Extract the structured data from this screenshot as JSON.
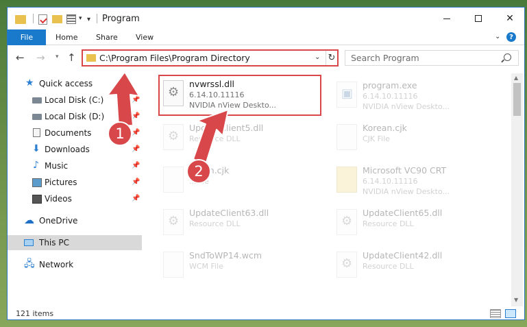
{
  "window": {
    "title": "Program",
    "ribbon_tabs": {
      "file": "File",
      "home": "Home",
      "share": "Share",
      "view": "View"
    },
    "help": "?"
  },
  "nav": {
    "address": "C:\\Program Files\\Program Directory",
    "search_placeholder": "Search Program"
  },
  "sidebar": {
    "quick_access": "Quick access",
    "items": [
      {
        "label": "Local Disk (C:)"
      },
      {
        "label": "Local Disk (D:)"
      },
      {
        "label": "Documents"
      },
      {
        "label": "Downloads"
      },
      {
        "label": "Music"
      },
      {
        "label": "Pictures"
      },
      {
        "label": "Videos"
      }
    ],
    "onedrive": "OneDrive",
    "this_pc": "This PC",
    "network": "Network"
  },
  "files": [
    {
      "name": "nvwrssl.dll",
      "line2": "6.14.10.11116",
      "line3": "NVIDIA nView Deskto..."
    },
    {
      "name": "program.exe",
      "line2": "6.14.10.11116",
      "line3": "NVIDIA nView Deskto..."
    },
    {
      "name": "UpdateClient5.dll",
      "line2": "Resource DLL",
      "line3": ""
    },
    {
      "name": "Korean.cjk",
      "line2": "CJK File",
      "line3": ""
    },
    {
      "name": "...tem.cjk",
      "line2": "...File",
      "line3": ""
    },
    {
      "name": "Microsoft VC90 CRT",
      "line2": "6.14.10.11116",
      "line3": "NVIDIA nView Deskto..."
    },
    {
      "name": "UpdateClient63.dll",
      "line2": "Resource DLL",
      "line3": ""
    },
    {
      "name": "UpdateClient65.dll",
      "line2": "Resource DLL",
      "line3": ""
    },
    {
      "name": "SndToWP14.wcm",
      "line2": "WCM File",
      "line3": ""
    },
    {
      "name": "UpdateClient42.dll",
      "line2": "Resource DLL",
      "line3": ""
    }
  ],
  "status": {
    "item_count": "121 items"
  },
  "annotations": {
    "step1": "1",
    "step2": "2",
    "color": "#d8474a"
  }
}
